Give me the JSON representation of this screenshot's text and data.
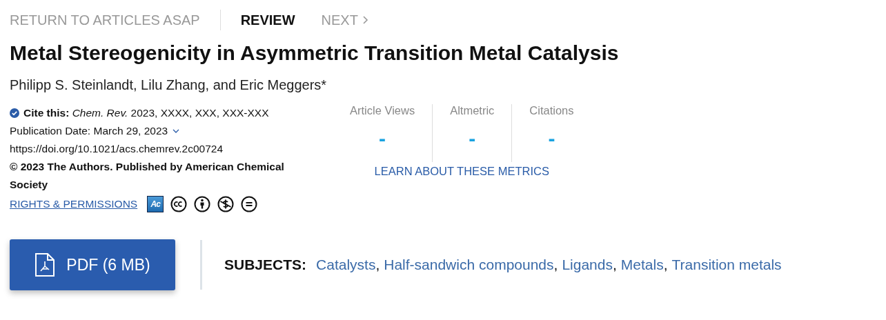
{
  "nav": [
    {
      "label": "RETURN TO ARTICLES ASAP",
      "kind": "link"
    },
    {
      "label": "REVIEW",
      "kind": "type"
    },
    {
      "label": "NEXT",
      "kind": "next"
    }
  ],
  "title": "Metal Stereogenicity in Asymmetric Transition Metal Catalysis",
  "authors": "Philipp S. Steinlandt, Lilu Zhang, and Eric Meggers*",
  "cite": "**Cite this:** *Chem. Rev.*  2023, XXXX, XXX, XXX-XXX",
  "publication_date": "Publication Date: March 29, 2023",
  "doi": "https://doi.org/10.1021/acs.chemrev.2c00724",
  "copyright": "© 2023 The Authors. Published by American Chemical Society",
  "rights_link": "RIGHTS & PERMISSIONS",
  "access_badge": "Ac",
  "license_icons": [
    {
      "kind": "cc"
    },
    {
      "kind": "by"
    },
    {
      "kind": "nc"
    },
    {
      "kind": "nd"
    }
  ],
  "metrics": [
    {
      "label": "Article Views",
      "value": "-"
    },
    {
      "label": "Altmetric",
      "value": "-"
    },
    {
      "label": "Citations",
      "value": "-"
    }
  ],
  "metrics_link": "LEARN ABOUT THESE METRICS",
  "pdf_button": "PDF (6 MB)",
  "subjects": {
    "label": "SUBJECTS:",
    "items": [
      {
        "label": "Catalysts",
        "suffix": ","
      },
      {
        "label": "Half-sandwich compounds",
        "suffix": ","
      },
      {
        "label": "Ligands",
        "suffix": ","
      },
      {
        "label": "Metals",
        "suffix": ","
      },
      {
        "label": "Transition metals"
      }
    ]
  }
}
